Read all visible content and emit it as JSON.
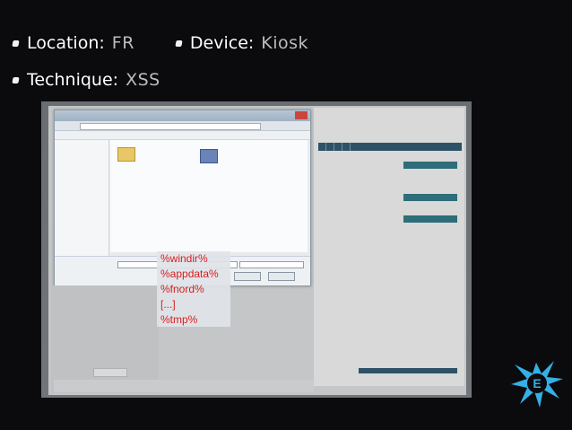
{
  "header": {
    "location_label": "Location:",
    "location_value": "FR",
    "device_label": "Device:",
    "device_value": "Kiosk",
    "technique_label": "Technique:",
    "technique_value": "XSS"
  },
  "overlay": {
    "items": [
      "%windir%",
      "%appdata%",
      "%fnord%",
      "[...]",
      "%tmp%"
    ]
  },
  "logo": {
    "letter": "E"
  },
  "colors": {
    "background": "#0b0b0d",
    "overlay_text": "#d62020",
    "logo": "#34b0e6"
  }
}
